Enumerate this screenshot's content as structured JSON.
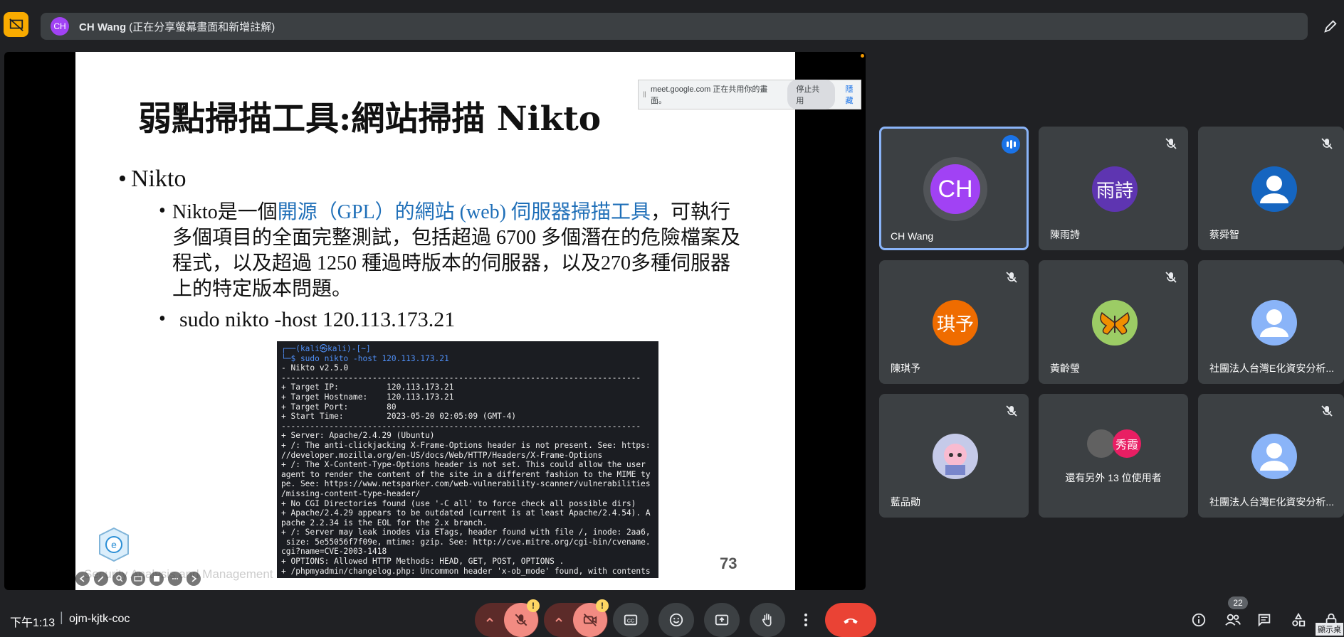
{
  "header": {
    "presenter_initials": "CH",
    "presenter_name": "CH Wang",
    "presenter_status": " (正在分享螢幕畫面和新增註解)"
  },
  "slide": {
    "title": "弱點掃描工具:網站掃描 Nikto",
    "bullet1": "Nikto",
    "bullet2_prefix": "Nikto是一個",
    "bullet2_blue": "開源（GPL）的網站 (web) 伺服器掃描工具",
    "bullet2_rest": "，可執行多個項目的全面完整測試，包括超過 6700 多個潛在的危險檔案及程式，以及超過 1250 種過時版本的伺服器，以及270多種伺服器上的特定版本問題。",
    "bullet3": "sudo nikto -host 120.113.173.21",
    "terminal_lines": [
      "┌──(kali㉿kali)-[~]",
      "└─$ sudo nikto -host 120.113.173.21",
      "- Nikto v2.5.0",
      "---------------------------------------------------------------------------",
      "+ Target IP:          120.113.173.21",
      "+ Target Hostname:    120.113.173.21",
      "+ Target Port:        80",
      "+ Start Time:         2023-05-20 02:05:09 (GMT-4)",
      "---------------------------------------------------------------------------",
      "+ Server: Apache/2.4.29 (Ubuntu)",
      "+ /: The anti-clickjacking X-Frame-Options header is not present. See: https:",
      "//developer.mozilla.org/en-US/docs/Web/HTTP/Headers/X-Frame-Options",
      "+ /: The X-Content-Type-Options header is not set. This could allow the user",
      "agent to render the content of the site in a different fashion to the MIME ty",
      "pe. See: https://www.netsparker.com/web-vulnerability-scanner/vulnerabilities",
      "/missing-content-type-header/",
      "+ No CGI Directories found (use '-C all' to force check all possible dirs)",
      "+ Apache/2.4.29 appears to be outdated (current is at least Apache/2.4.54). A",
      "pache 2.2.34 is the EOL for the 2.x branch.",
      "+ /: Server may leak inodes via ETags, header found with file /, inode: 2aa6,",
      " size: 5e55056f7f09e, mtime: gzip. See: http://cve.mitre.org/cgi-bin/cvename.",
      "cgi?name=CVE-2003-1418",
      "+ OPTIONS: Allowed HTTP Methods: HEAD, GET, POST, OPTIONS .",
      "+ /phpmyadmin/changelog.php: Uncommon header 'x-ob_mode' found, with contents"
    ],
    "page_number": "73",
    "footer": "Security Analysis and Management"
  },
  "share_banner": {
    "text": "meet.google.com 正在共用你的畫面。",
    "stop_label": "停止共用",
    "hide_label": "隱藏"
  },
  "participants": [
    {
      "name": "CH Wang",
      "initials": "CH",
      "color": "#a142f4"
    },
    {
      "name": "陳雨詩",
      "initials": "雨詩",
      "color": "#5e35b1"
    },
    {
      "name": "蔡舜智",
      "initials": "",
      "color": "#1565c0"
    },
    {
      "name": "陳琪予",
      "initials": "琪予",
      "color": "#ef6c00"
    },
    {
      "name": "黃齡瑩",
      "initials": "",
      "color": "#9ccc65"
    },
    {
      "name": "社團法人台灣E化資安分析...",
      "initials": "",
      "color": "#8ab4f8"
    },
    {
      "name": "藍品勛",
      "initials": "",
      "color": "#c5cae9"
    },
    {
      "name": "還有另外 13 位使用者",
      "initials": "秀霞",
      "color": "#e91e63"
    },
    {
      "name": "社團法人台灣E化資安分析...",
      "initials": "",
      "color": "#8ab4f8"
    }
  ],
  "footer": {
    "time": "下午1:13",
    "separator": "|",
    "meeting_code": "ojm-kjtk-coc",
    "people_count": "22",
    "desktop_label": "顯示桌"
  },
  "colors": {
    "background": "#202124",
    "tile": "#3c4043",
    "end_call": "#ea4335",
    "warning": "#fdd663",
    "muted_button": "#f28b82"
  }
}
